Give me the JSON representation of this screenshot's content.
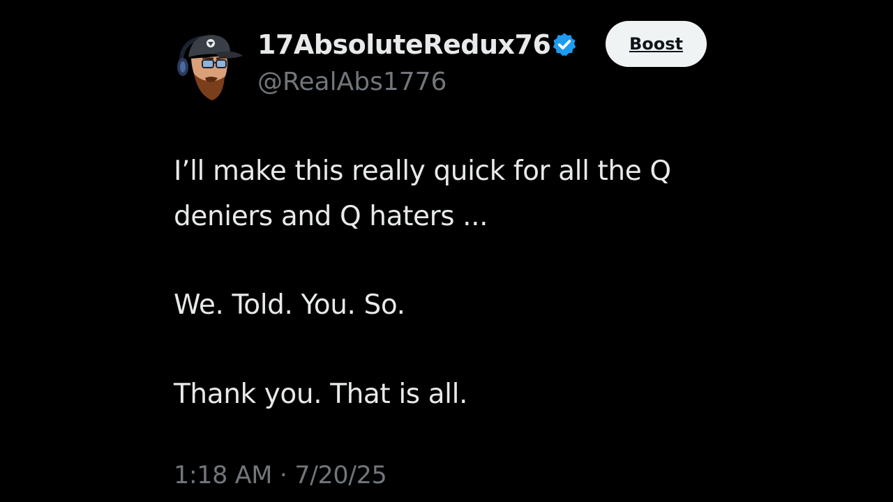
{
  "post": {
    "author": {
      "display_name": "17AbsoluteRedux76",
      "handle": "@RealAbs1776",
      "verified": true,
      "avatar_icon": "avatar-cartoon-man-cap-headset",
      "verified_icon": "verified-badge-icon"
    },
    "boost_button": {
      "label": "Boost"
    },
    "body": {
      "line1": "I’ll make this really quick for all the Q",
      "line2": "deniers and Q haters ...",
      "line3": "We. Told. You. So.",
      "line4": "Thank you. That is all."
    },
    "timestamp": "1:18 AM · 7/20/25"
  },
  "colors": {
    "background": "#000000",
    "primary_text": "#e7e9ea",
    "secondary_text": "#71767b",
    "verified_blue": "#1d9bf0",
    "button_bg": "#eff3f4",
    "button_text": "#0f1419"
  }
}
